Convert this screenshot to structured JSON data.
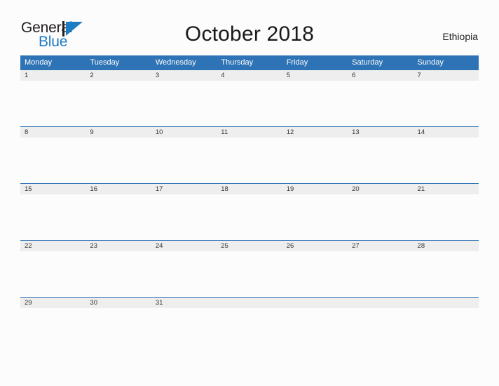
{
  "brand": {
    "name_part1": "General",
    "name_part2": "Blue",
    "triangle_icon": "triangle-icon",
    "colors": {
      "dark": "#231f20",
      "blue": "#1d7cc4"
    }
  },
  "header": {
    "title": "October 2018",
    "region": "Ethiopia"
  },
  "theme": {
    "header_blue": "#2e73b5",
    "row_gray": "#eeeeee",
    "page_background": "#fcfcfd",
    "text": "#333333"
  },
  "calendar": {
    "month": "October",
    "year": "2018",
    "weekday_headers": [
      "Monday",
      "Tuesday",
      "Wednesday",
      "Thursday",
      "Friday",
      "Saturday",
      "Sunday"
    ],
    "weeks": [
      [
        {
          "day": "1"
        },
        {
          "day": "2"
        },
        {
          "day": "3"
        },
        {
          "day": "4"
        },
        {
          "day": "5"
        },
        {
          "day": "6"
        },
        {
          "day": "7"
        }
      ],
      [
        {
          "day": "8"
        },
        {
          "day": "9"
        },
        {
          "day": "10"
        },
        {
          "day": "11"
        },
        {
          "day": "12"
        },
        {
          "day": "13"
        },
        {
          "day": "14"
        }
      ],
      [
        {
          "day": "15"
        },
        {
          "day": "16"
        },
        {
          "day": "17"
        },
        {
          "day": "18"
        },
        {
          "day": "19"
        },
        {
          "day": "20"
        },
        {
          "day": "21"
        }
      ],
      [
        {
          "day": "22"
        },
        {
          "day": "23"
        },
        {
          "day": "24"
        },
        {
          "day": "25"
        },
        {
          "day": "26"
        },
        {
          "day": "27"
        },
        {
          "day": "28"
        }
      ],
      [
        {
          "day": "29"
        },
        {
          "day": "30"
        },
        {
          "day": "31"
        },
        {
          "day": ""
        },
        {
          "day": ""
        },
        {
          "day": ""
        },
        {
          "day": ""
        }
      ]
    ]
  }
}
